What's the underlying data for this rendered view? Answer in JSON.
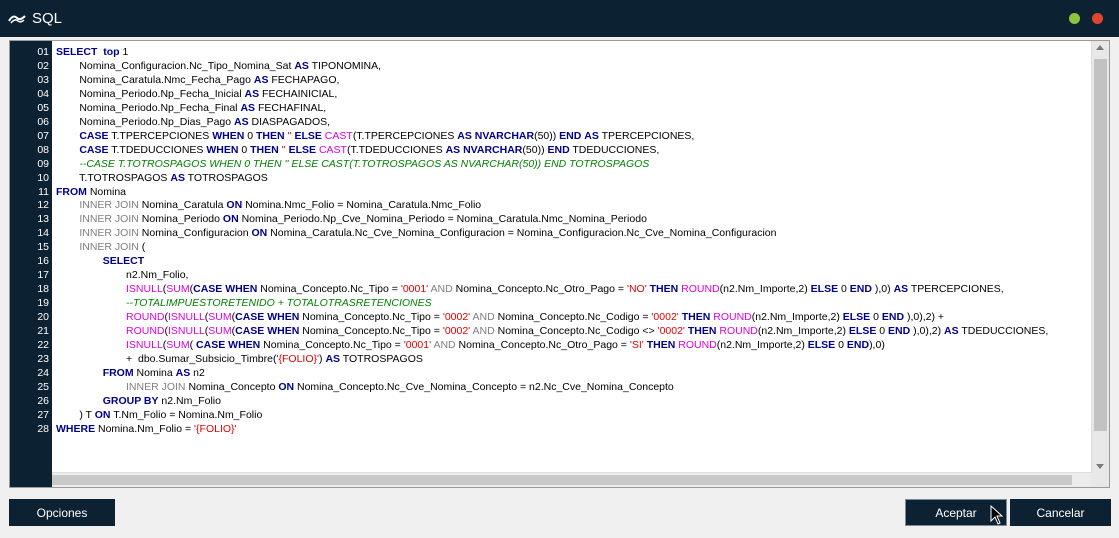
{
  "window": {
    "title": "SQL"
  },
  "buttons": {
    "opciones": "Opciones",
    "aceptar": "Aceptar",
    "cancelar": "Cancelar"
  },
  "editor": {
    "lines": [
      [
        [
          "kw",
          "SELECT  top "
        ],
        [
          "t",
          "1"
        ]
      ],
      [
        [
          "t",
          "        Nomina_Configuracion.Nc_Tipo_Nomina_Sat "
        ],
        [
          "kw",
          "AS"
        ],
        [
          "t",
          " TIPONOMINA,"
        ]
      ],
      [
        [
          "t",
          "        Nomina_Caratula.Nmc_Fecha_Pago "
        ],
        [
          "kw",
          "AS"
        ],
        [
          "t",
          " FECHAPAGO,"
        ]
      ],
      [
        [
          "t",
          "        Nomina_Periodo.Np_Fecha_Inicial "
        ],
        [
          "kw",
          "AS"
        ],
        [
          "t",
          " FECHAINICIAL,"
        ]
      ],
      [
        [
          "t",
          "        Nomina_Periodo.Np_Fecha_Final "
        ],
        [
          "kw",
          "AS"
        ],
        [
          "t",
          " FECHAFINAL,"
        ]
      ],
      [
        [
          "t",
          "        Nomina_Periodo.Np_Dias_Pago "
        ],
        [
          "kw",
          "AS"
        ],
        [
          "t",
          " DIASPAGADOS,"
        ]
      ],
      [
        [
          "t",
          "        "
        ],
        [
          "kw",
          "CASE"
        ],
        [
          "t",
          " T.TPERCEPCIONES "
        ],
        [
          "kw",
          "WHEN"
        ],
        [
          "t",
          " 0 "
        ],
        [
          "kw",
          "THEN"
        ],
        [
          "t",
          " "
        ],
        [
          "str",
          "''"
        ],
        [
          "t",
          " "
        ],
        [
          "kw",
          "ELSE"
        ],
        [
          "t",
          " "
        ],
        [
          "fn",
          "CAST"
        ],
        [
          "t",
          "(T.TPERCEPCIONES "
        ],
        [
          "kw",
          "AS"
        ],
        [
          "t",
          " "
        ],
        [
          "kw",
          "NVARCHAR"
        ],
        [
          "t",
          "(50)) "
        ],
        [
          "kw",
          "END"
        ],
        [
          "t",
          " "
        ],
        [
          "kw",
          "AS"
        ],
        [
          "t",
          " TPERCEPCIONES,"
        ]
      ],
      [
        [
          "t",
          "        "
        ],
        [
          "kw",
          "CASE"
        ],
        [
          "t",
          " T.TDEDUCCIONES "
        ],
        [
          "kw",
          "WHEN"
        ],
        [
          "t",
          " 0 "
        ],
        [
          "kw",
          "THEN"
        ],
        [
          "t",
          " "
        ],
        [
          "str",
          "''"
        ],
        [
          "t",
          " "
        ],
        [
          "kw",
          "ELSE"
        ],
        [
          "t",
          " "
        ],
        [
          "fn",
          "CAST"
        ],
        [
          "t",
          "(T.TDEDUCCIONES "
        ],
        [
          "kw",
          "AS"
        ],
        [
          "t",
          " "
        ],
        [
          "kw",
          "NVARCHAR"
        ],
        [
          "t",
          "(50)) "
        ],
        [
          "kw",
          "END"
        ],
        [
          "t",
          " TDEDUCCIONES,"
        ]
      ],
      [
        [
          "t",
          "        "
        ],
        [
          "cmt",
          "--CASE T.TOTROSPAGOS WHEN 0 THEN '' ELSE CAST(T.TOTROSPAGOS AS NVARCHAR(50)) END TOTROSPAGOS"
        ]
      ],
      [
        [
          "t",
          "        T.TOTROSPAGOS "
        ],
        [
          "kw",
          "AS"
        ],
        [
          "t",
          " TOTROSPAGOS"
        ]
      ],
      [
        [
          "kw",
          "FROM"
        ],
        [
          "t",
          " Nomina"
        ]
      ],
      [
        [
          "t",
          "        "
        ],
        [
          "gray",
          "INNER JOIN"
        ],
        [
          "t",
          " Nomina_Caratula "
        ],
        [
          "kw",
          "ON"
        ],
        [
          "t",
          " Nomina.Nmc_Folio = Nomina_Caratula.Nmc_Folio"
        ]
      ],
      [
        [
          "t",
          "        "
        ],
        [
          "gray",
          "INNER JOIN"
        ],
        [
          "t",
          " Nomina_Periodo "
        ],
        [
          "kw",
          "ON"
        ],
        [
          "t",
          " Nomina_Periodo.Np_Cve_Nomina_Periodo = Nomina_Caratula.Nmc_Nomina_Periodo"
        ]
      ],
      [
        [
          "t",
          "        "
        ],
        [
          "gray",
          "INNER JOIN"
        ],
        [
          "t",
          " Nomina_Configuracion "
        ],
        [
          "kw",
          "ON"
        ],
        [
          "t",
          " Nomina_Caratula.Nc_Cve_Nomina_Configuracion = Nomina_Configuracion.Nc_Cve_Nomina_Configuracion"
        ]
      ],
      [
        [
          "t",
          "        "
        ],
        [
          "gray",
          "INNER JOIN"
        ],
        [
          "t",
          " ("
        ]
      ],
      [
        [
          "t",
          "                "
        ],
        [
          "kw",
          "SELECT"
        ]
      ],
      [
        [
          "t",
          "                        n2.Nm_Folio,"
        ]
      ],
      [
        [
          "t",
          "                        "
        ],
        [
          "fn",
          "ISNULL"
        ],
        [
          "t",
          "("
        ],
        [
          "fn",
          "SUM"
        ],
        [
          "t",
          "("
        ],
        [
          "kw",
          "CASE"
        ],
        [
          "t",
          " "
        ],
        [
          "kw",
          "WHEN"
        ],
        [
          "t",
          " Nomina_Concepto.Nc_Tipo = "
        ],
        [
          "str",
          "'0001'"
        ],
        [
          "t",
          " "
        ],
        [
          "gray",
          "AND"
        ],
        [
          "t",
          " Nomina_Concepto.Nc_Otro_Pago = "
        ],
        [
          "str",
          "'NO'"
        ],
        [
          "t",
          " "
        ],
        [
          "kw",
          "THEN"
        ],
        [
          "t",
          " "
        ],
        [
          "fn",
          "ROUND"
        ],
        [
          "t",
          "(n2.Nm_Importe,2) "
        ],
        [
          "kw",
          "ELSE"
        ],
        [
          "t",
          " 0 "
        ],
        [
          "kw",
          "END"
        ],
        [
          "t",
          " ),0) "
        ],
        [
          "kw",
          "AS"
        ],
        [
          "t",
          " TPERCEPCIONES,"
        ]
      ],
      [
        [
          "t",
          "                        "
        ],
        [
          "cmt",
          "--TOTALIMPUESTORETENIDO + TOTALOTRASRETENCIONES"
        ]
      ],
      [
        [
          "t",
          "                        "
        ],
        [
          "fn",
          "ROUND"
        ],
        [
          "t",
          "("
        ],
        [
          "fn",
          "ISNULL"
        ],
        [
          "t",
          "("
        ],
        [
          "fn",
          "SUM"
        ],
        [
          "t",
          "("
        ],
        [
          "kw",
          "CASE"
        ],
        [
          "t",
          " "
        ],
        [
          "kw",
          "WHEN"
        ],
        [
          "t",
          " Nomina_Concepto.Nc_Tipo = "
        ],
        [
          "str",
          "'0002'"
        ],
        [
          "t",
          " "
        ],
        [
          "gray",
          "AND"
        ],
        [
          "t",
          " Nomina_Concepto.Nc_Codigo = "
        ],
        [
          "str",
          "'0002'"
        ],
        [
          "t",
          " "
        ],
        [
          "kw",
          "THEN"
        ],
        [
          "t",
          " "
        ],
        [
          "fn",
          "ROUND"
        ],
        [
          "t",
          "(n2.Nm_Importe,2) "
        ],
        [
          "kw",
          "ELSE"
        ],
        [
          "t",
          " 0 "
        ],
        [
          "kw",
          "END"
        ],
        [
          "t",
          " ),0),2) +"
        ]
      ],
      [
        [
          "t",
          "                        "
        ],
        [
          "fn",
          "ROUND"
        ],
        [
          "t",
          "("
        ],
        [
          "fn",
          "ISNULL"
        ],
        [
          "t",
          "("
        ],
        [
          "fn",
          "SUM"
        ],
        [
          "t",
          "("
        ],
        [
          "kw",
          "CASE"
        ],
        [
          "t",
          " "
        ],
        [
          "kw",
          "WHEN"
        ],
        [
          "t",
          " Nomina_Concepto.Nc_Tipo = "
        ],
        [
          "str",
          "'0002'"
        ],
        [
          "t",
          " "
        ],
        [
          "gray",
          "AND"
        ],
        [
          "t",
          " Nomina_Concepto.Nc_Codigo <> "
        ],
        [
          "str",
          "'0002'"
        ],
        [
          "t",
          " "
        ],
        [
          "kw",
          "THEN"
        ],
        [
          "t",
          " "
        ],
        [
          "fn",
          "ROUND"
        ],
        [
          "t",
          "(n2.Nm_Importe,2) "
        ],
        [
          "kw",
          "ELSE"
        ],
        [
          "t",
          " 0 "
        ],
        [
          "kw",
          "END"
        ],
        [
          "t",
          " ),0),2) "
        ],
        [
          "kw",
          "AS"
        ],
        [
          "t",
          " TDEDUCCIONES,"
        ]
      ],
      [
        [
          "t",
          "                        "
        ],
        [
          "fn",
          "ISNULL"
        ],
        [
          "t",
          "("
        ],
        [
          "fn",
          "SUM"
        ],
        [
          "t",
          "( "
        ],
        [
          "kw",
          "CASE"
        ],
        [
          "t",
          " "
        ],
        [
          "kw",
          "WHEN"
        ],
        [
          "t",
          " Nomina_Concepto.Nc_Tipo = "
        ],
        [
          "str",
          "'0001'"
        ],
        [
          "t",
          " "
        ],
        [
          "gray",
          "AND"
        ],
        [
          "t",
          " Nomina_Concepto.Nc_Otro_Pago = "
        ],
        [
          "str",
          "'SI'"
        ],
        [
          "t",
          " "
        ],
        [
          "kw",
          "THEN"
        ],
        [
          "t",
          " "
        ],
        [
          "fn",
          "ROUND"
        ],
        [
          "t",
          "(n2.Nm_Importe,2) "
        ],
        [
          "kw",
          "ELSE"
        ],
        [
          "t",
          " 0 "
        ],
        [
          "kw",
          "END"
        ],
        [
          "t",
          "),0)"
        ]
      ],
      [
        [
          "t",
          "                        +  dbo.Sumar_Subsicio_Timbre("
        ],
        [
          "str",
          "'{FOLIO}'"
        ],
        [
          "t",
          ") "
        ],
        [
          "kw",
          "AS"
        ],
        [
          "t",
          " TOTROSPAGOS"
        ]
      ],
      [
        [
          "t",
          "                "
        ],
        [
          "kw",
          "FROM"
        ],
        [
          "t",
          " Nomina "
        ],
        [
          "kw",
          "AS"
        ],
        [
          "t",
          " n2"
        ]
      ],
      [
        [
          "t",
          "                        "
        ],
        [
          "gray",
          "INNER JOIN"
        ],
        [
          "t",
          " Nomina_Concepto "
        ],
        [
          "kw",
          "ON"
        ],
        [
          "t",
          " Nomina_Concepto.Nc_Cve_Nomina_Concepto = n2.Nc_Cve_Nomina_Concepto"
        ]
      ],
      [
        [
          "t",
          "                "
        ],
        [
          "kw",
          "GROUP BY"
        ],
        [
          "t",
          " n2.Nm_Folio"
        ]
      ],
      [
        [
          "t",
          "        ) T "
        ],
        [
          "kw",
          "ON"
        ],
        [
          "t",
          " T.Nm_Folio = Nomina.Nm_Folio"
        ]
      ],
      [
        [
          "kw",
          "WHERE"
        ],
        [
          "t",
          " Nomina.Nm_Folio = "
        ],
        [
          "str",
          "'{FOLIO}'"
        ]
      ]
    ]
  }
}
